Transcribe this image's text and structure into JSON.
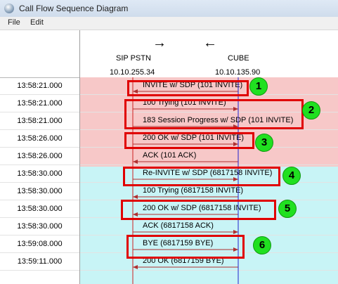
{
  "window": {
    "title": "Call Flow Sequence Diagram"
  },
  "menu": [
    "File",
    "Edit"
  ],
  "colors": {
    "red_band": "#f7c8c8",
    "cyan_band": "#c8f4f6",
    "sip_line": "#cc2222",
    "cube_line": "#2222cc",
    "highlight": "#e00000",
    "badge": "#20e020"
  },
  "header": {
    "left_arrow": "→",
    "right_arrow": "←",
    "endpoint_left": "SIP PSTN",
    "endpoint_right": "CUBE",
    "ip_left": "10.10.255.34",
    "ip_right": "10.10.135.90"
  },
  "rows": [
    {
      "time": "13:58:21.000",
      "label": "INVITE w/ SDP (101 INVITE)",
      "dir": "left"
    },
    {
      "time": "13:58:21.000",
      "label": "100 Trying (101 INVITE)",
      "dir": "right"
    },
    {
      "time": "13:58:21.000",
      "label": "183 Session Progress w/ SDP (101 INVITE)",
      "dir": "right"
    },
    {
      "time": "13:58:26.000",
      "label": "200 OK w/ SDP (101 INVITE)",
      "dir": "right"
    },
    {
      "time": "13:58:26.000",
      "label": "ACK (101 ACK)",
      "dir": "left"
    },
    {
      "time": "13:58:30.000",
      "label": "Re-INVITE w/ SDP (6817158 INVITE)",
      "dir": "right"
    },
    {
      "time": "13:58:30.000",
      "label": "100 Trying (6817158 INVITE)",
      "dir": "left"
    },
    {
      "time": "13:58:30.000",
      "label": "200 OK w/ SDP (6817158 INVITE)",
      "dir": "left"
    },
    {
      "time": "13:58:30.000",
      "label": "ACK (6817158 ACK)",
      "dir": "right"
    },
    {
      "time": "13:59:08.000",
      "label": "BYE (6817159 BYE)",
      "dir": "right"
    },
    {
      "time": "13:59:11.000",
      "label": "200 OK (6817159 BYE)",
      "dir": "left"
    }
  ],
  "badges": [
    "1",
    "2",
    "3",
    "4",
    "5",
    "6"
  ]
}
